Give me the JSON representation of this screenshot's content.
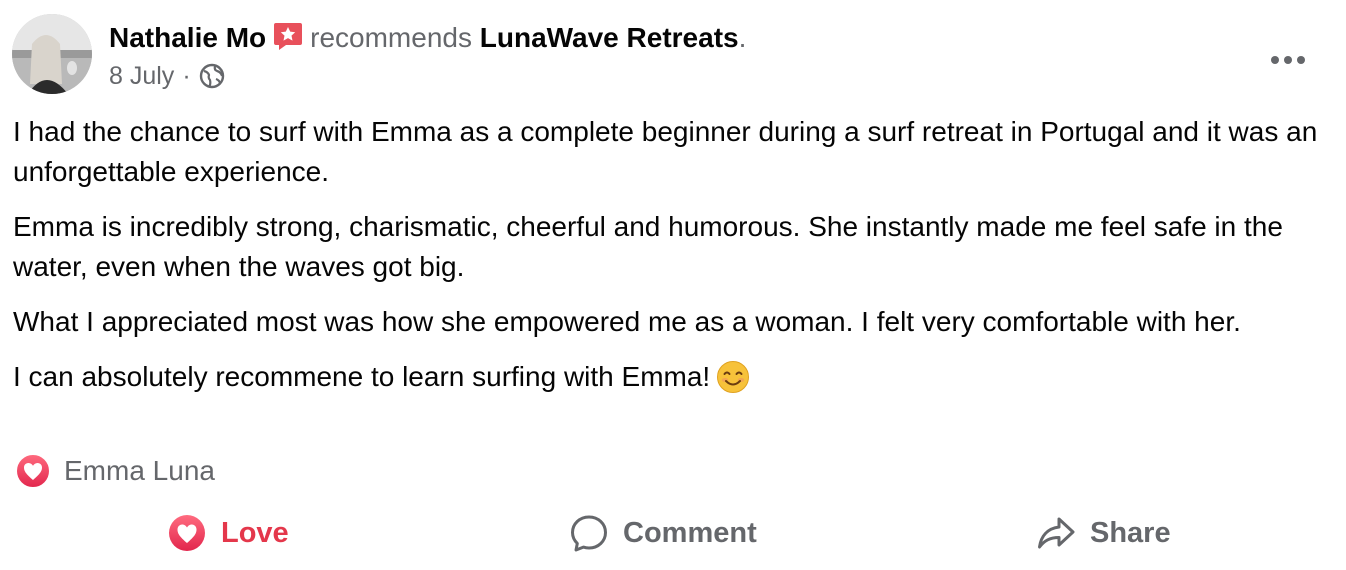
{
  "post": {
    "author": "Nathalie Mo",
    "verb": "recommends",
    "page": "LunaWave Retreats",
    "punct": ".",
    "date": "8 July",
    "separator": "·",
    "paragraphs": [
      "I had the chance to surf with Emma as a complete beginner during a surf retreat in Portugal and it was an unforgettable experience.",
      "Emma is incredibly strong, charismatic, cheerful and humorous. She instantly made me feel safe in the water, even when the waves got big.",
      "What I appreciated most was how she empowered me as a woman. I felt very comfortable with her.",
      "I can absolutely recommene to learn surfing with Emma!"
    ],
    "emoji": "smiling-face-icon"
  },
  "reactions": {
    "icon": "love-reaction-icon",
    "names": "Emma Luna"
  },
  "actions": {
    "love_label": "Love",
    "comment_label": "Comment",
    "share_label": "Share"
  },
  "colors": {
    "love": "#e4374b",
    "muted": "#65676b",
    "text": "#050505",
    "badge": "#e8505b"
  }
}
